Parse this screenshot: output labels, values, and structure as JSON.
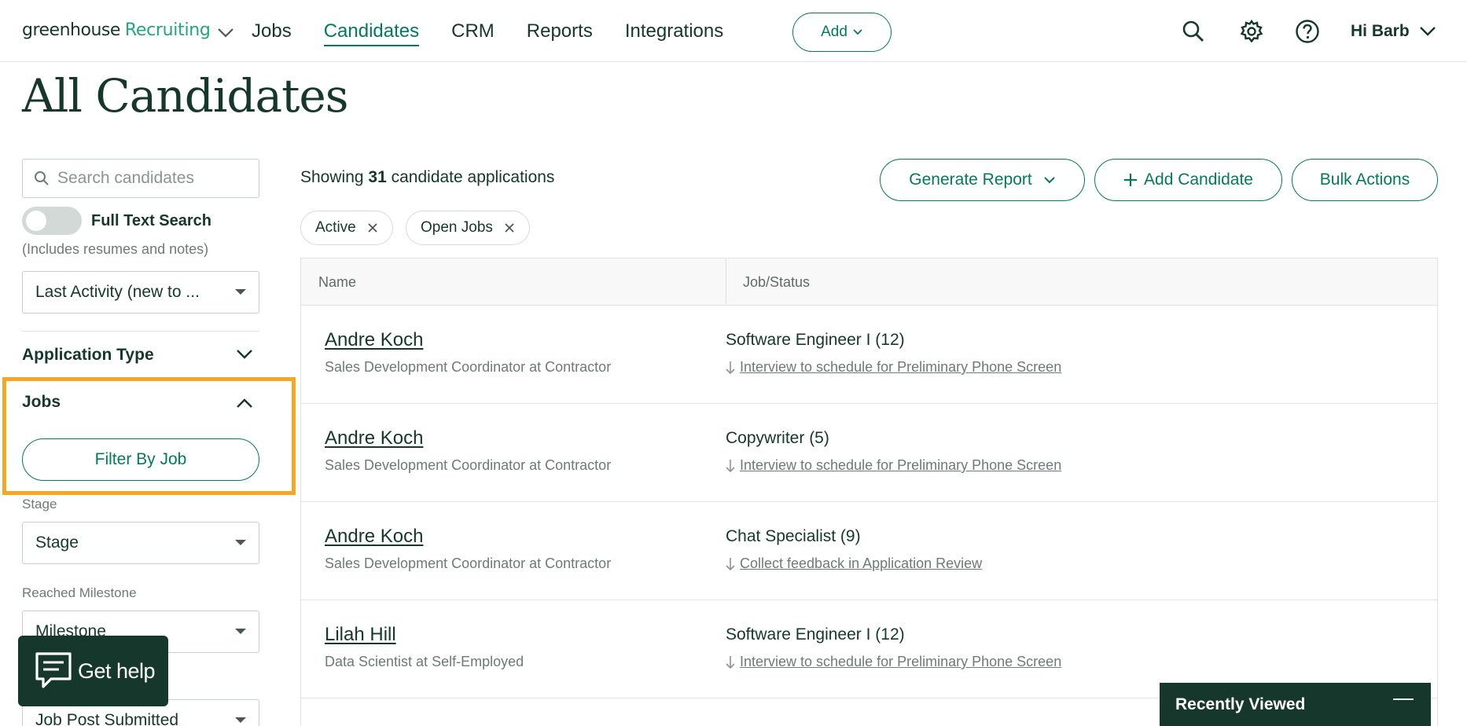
{
  "nav": {
    "logo_text": "greenhouse",
    "logo_product": "Recruiting",
    "links": [
      "Jobs",
      "Candidates",
      "CRM",
      "Reports",
      "Integrations"
    ],
    "active": "Candidates",
    "add_label": "Add",
    "user_label": "Hi Barb"
  },
  "page_title": "All Candidates",
  "sidebar": {
    "search_placeholder": "Search candidates",
    "full_text_label": "Full Text Search",
    "full_text_sub": "(Includes resumes and notes)",
    "sort_value": "Last Activity (new to ...",
    "application_type_label": "Application Type",
    "jobs_label": "Jobs",
    "filter_by_job_label": "Filter By Job",
    "stage_label": "Stage",
    "stage_value": "Stage",
    "milestone_label": "Reached Milestone",
    "milestone_value": "Milestone",
    "job_post_value": "Job Post Submitted"
  },
  "main": {
    "showing_prefix": "Showing",
    "showing_count": "31",
    "showing_suffix": "candidate applications",
    "generate_report_label": "Generate Report",
    "add_candidate_label": "Add Candidate",
    "bulk_actions_label": "Bulk Actions",
    "chips": [
      "Active",
      "Open Jobs"
    ],
    "columns": [
      "Name",
      "Job/Status"
    ],
    "rows": [
      {
        "name": "Andre Koch",
        "subtitle": "Sales Development Coordinator at Contractor",
        "job": "Software Engineer I (12)",
        "status": "Interview to schedule for Preliminary Phone Screen"
      },
      {
        "name": "Andre Koch",
        "subtitle": "Sales Development Coordinator at Contractor",
        "job": "Copywriter (5)",
        "status": "Interview to schedule for Preliminary Phone Screen"
      },
      {
        "name": "Andre Koch",
        "subtitle": "Sales Development Coordinator at Contractor",
        "job": "Chat Specialist (9)",
        "status": "Collect feedback in Application Review"
      },
      {
        "name": "Lilah Hill",
        "subtitle": "Data Scientist at Self-Employed",
        "job": "Software Engineer I (12)",
        "status": "Interview to schedule for Preliminary Phone Screen"
      }
    ]
  },
  "floating": {
    "get_help_label": "Get help",
    "recently_viewed_label": "Recently Viewed"
  },
  "colors": {
    "brand_dark": "#15372c",
    "brand_green": "#047a55",
    "highlight": "#f5a623"
  }
}
